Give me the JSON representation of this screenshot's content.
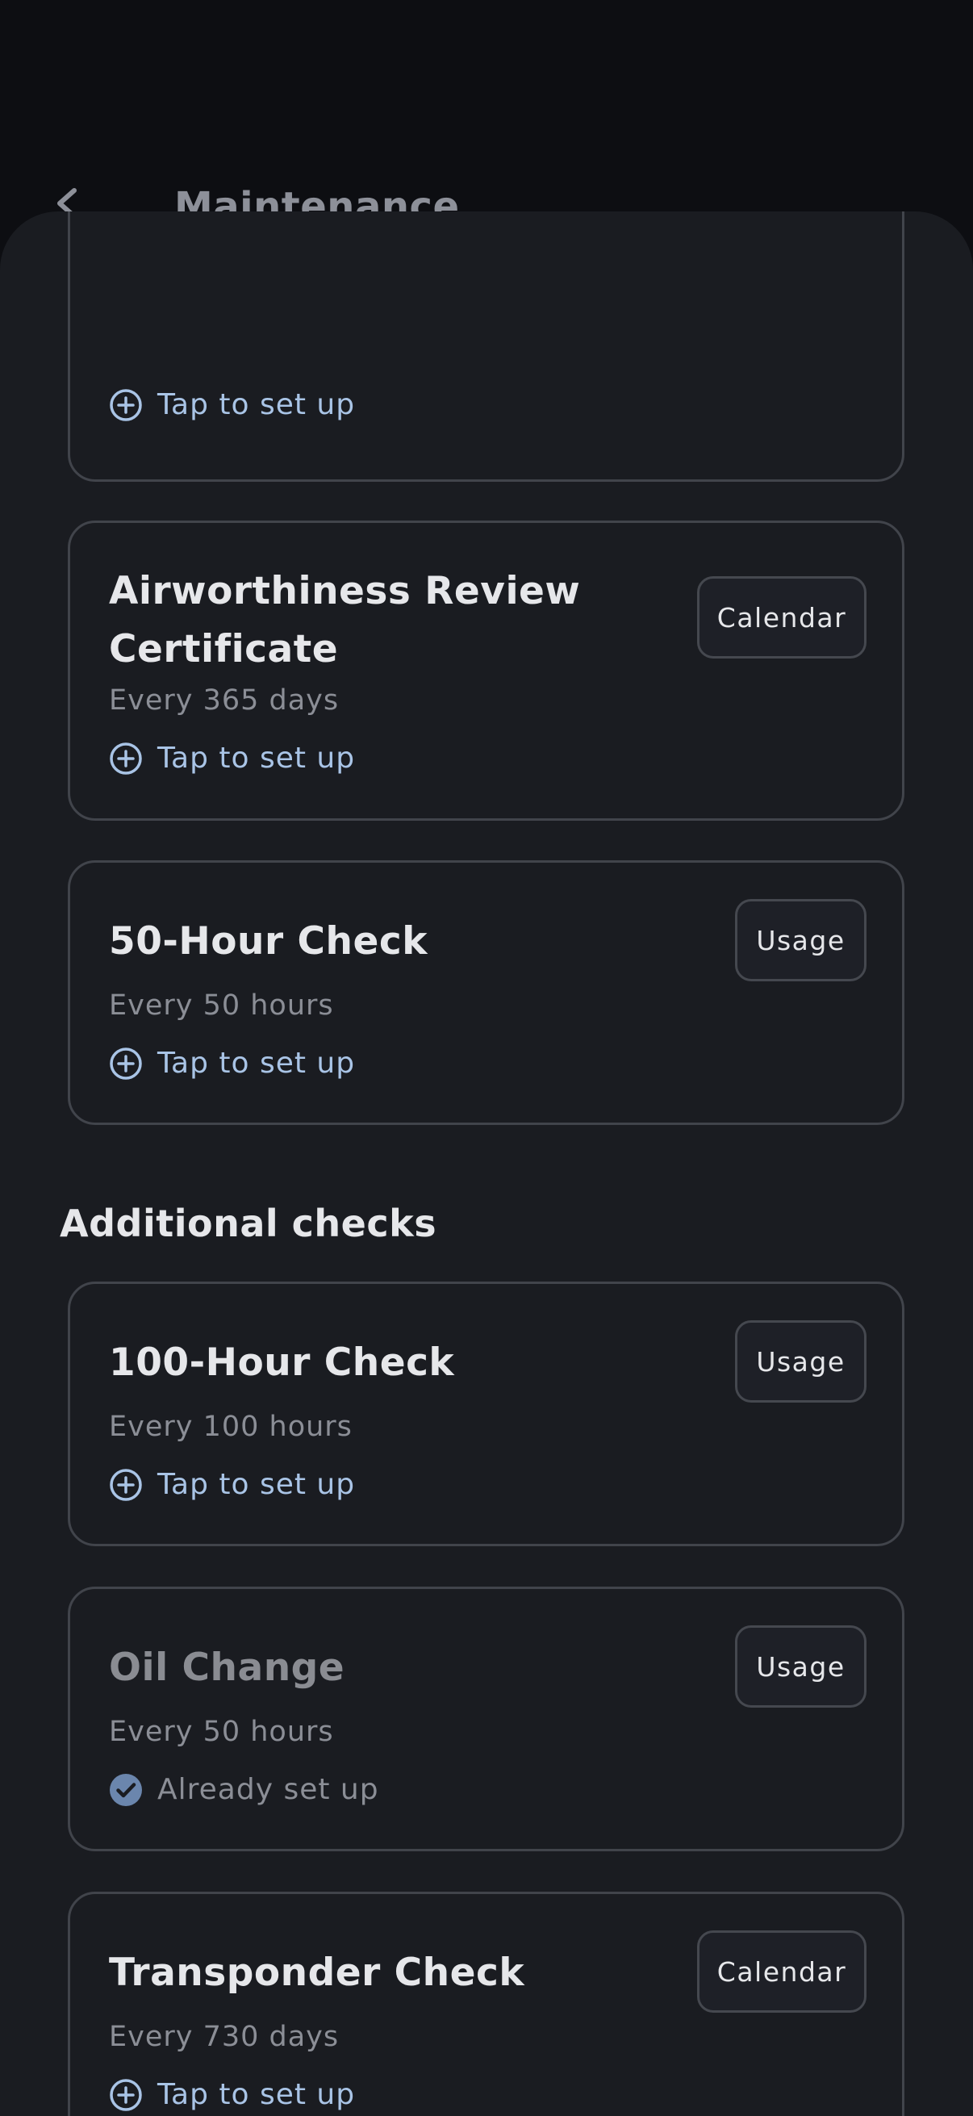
{
  "background": {
    "title": "Maintenance",
    "back_icon": "chevron-left-icon"
  },
  "cards_top": [
    {
      "title": "",
      "interval": "",
      "action": "Tap to set up",
      "action_icon": "plus-circle-icon"
    },
    {
      "title_line1": "Airworthiness Review",
      "title_line2": "Certificate",
      "interval": "Every 365 days",
      "action": "Tap to set up",
      "action_icon": "plus-circle-icon",
      "chip": "Calendar"
    },
    {
      "title": "50-Hour Check",
      "interval": "Every 50 hours",
      "action": "Tap to set up",
      "action_icon": "plus-circle-icon",
      "chip": "Usage"
    }
  ],
  "additional": {
    "heading": "Additional checks",
    "cards": [
      {
        "title": "100-Hour Check",
        "interval": "Every 100 hours",
        "action": "Tap to set up",
        "action_icon": "plus-circle-icon",
        "chip": "Usage"
      },
      {
        "title": "Oil Change",
        "interval": "Every 50 hours",
        "action": "Already set up",
        "action_icon": "check-circle-icon",
        "chip": "Usage"
      },
      {
        "title": "Transponder Check",
        "interval": "Every 730 days",
        "action": "Tap to set up",
        "action_icon": "plus-circle-icon",
        "chip": "Calendar"
      }
    ]
  },
  "colors": {
    "accent": "#a9c4e6",
    "sheet": "#1a1c21",
    "card_border": "#41444b",
    "check": "#6b86ad"
  }
}
